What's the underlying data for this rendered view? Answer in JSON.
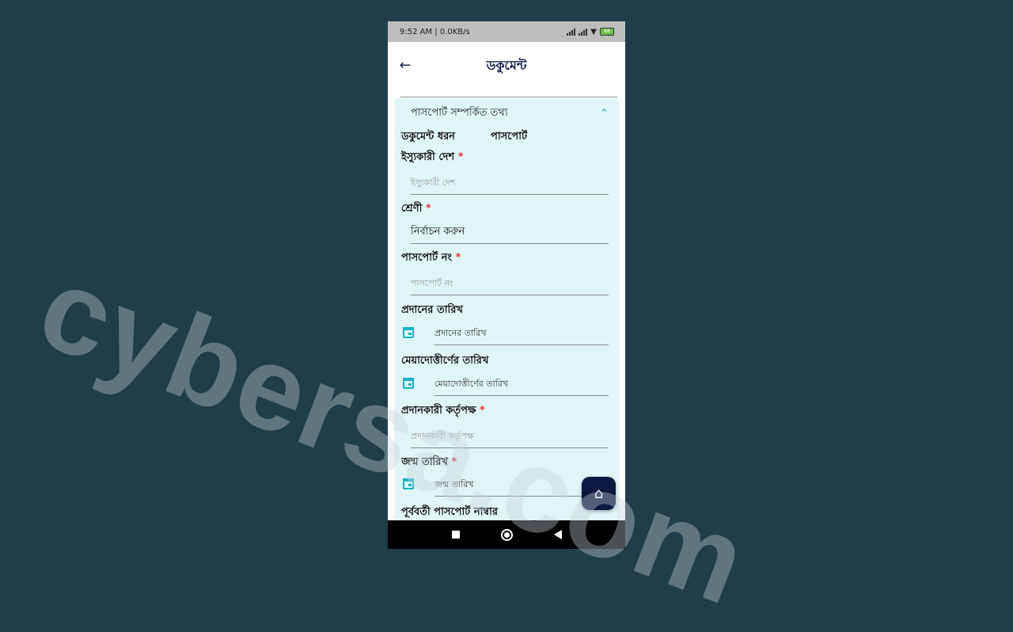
{
  "status": {
    "left": "9:52 AM | 0.0KB/s",
    "battery": "88"
  },
  "header": {
    "title": "ডকুমেন্ট"
  },
  "section": {
    "title": "পাসপোর্ট সম্পর্কিত তথ্য"
  },
  "document_type": {
    "label": "ডকুমেন্ট ধরন",
    "value": "পাসপোর্ট"
  },
  "fields": {
    "issuing_country": {
      "label": "ইস্যুকারী দেশ",
      "required": "*",
      "placeholder": "ইস্যুকারী দেশ"
    },
    "category": {
      "label": "শ্রেণী",
      "required": "*",
      "value": "নির্বাচন করুন"
    },
    "passport_no": {
      "label": "পাসপোর্ট নং",
      "required": "*",
      "placeholder": "পাসপোর্ট নং"
    },
    "issue_date": {
      "label": "প্রদানের তারিখ",
      "placeholder": "প্রদানের তারিখ"
    },
    "expiry_date": {
      "label": "মেয়াদোত্তীর্ণের তারিখ",
      "placeholder": "মেয়াদোত্তীর্ণের তারিখ"
    },
    "issuing_authority": {
      "label": "প্রদানকারী কর্তৃপক্ষ",
      "required": "*",
      "placeholder": "প্রদানকারী কর্তৃপক্ষ"
    },
    "birth_date": {
      "label": "জন্ম তারিখ",
      "required": "*",
      "placeholder": "জন্ম তারিখ"
    },
    "previous_passport": {
      "label": "পূর্ববর্তী পাসপোর্ট নাম্বার"
    }
  },
  "watermark": "cybersa.com",
  "colors": {
    "background": "#223d4a",
    "card": "#e0f5f8",
    "accent": "#19b3c8",
    "fab": "#0d1840",
    "required": "#e53935"
  },
  "icons": {
    "back": "arrow-left-icon",
    "chevron": "chevron-up-icon",
    "calendar": "calendar-icon",
    "home": "home-icon"
  }
}
